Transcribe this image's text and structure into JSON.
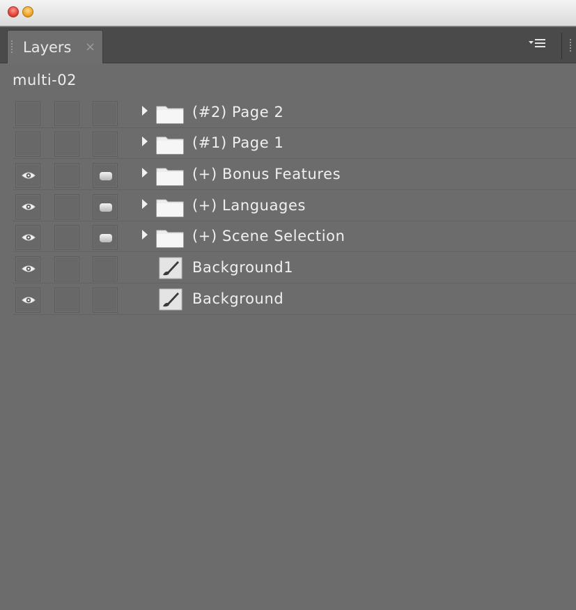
{
  "panel": {
    "tab_label": "Layers",
    "tab_close": "×",
    "menu_icon": "panel-menu-icon",
    "document_name": "multi-02"
  },
  "layers": [
    {
      "name": "(#2) Page 2",
      "type": "folder",
      "visible": false,
      "locked_marker": false
    },
    {
      "name": "(#1) Page 1",
      "type": "folder",
      "visible": false,
      "locked_marker": false
    },
    {
      "name": "(+) Bonus Features",
      "type": "folder",
      "visible": true,
      "locked_marker": true
    },
    {
      "name": "(+) Languages",
      "type": "folder",
      "visible": true,
      "locked_marker": true
    },
    {
      "name": "(+) Scene Selection",
      "type": "folder",
      "visible": true,
      "locked_marker": true
    },
    {
      "name": "Background1",
      "type": "layer",
      "visible": true,
      "locked_marker": false
    },
    {
      "name": "Background",
      "type": "layer",
      "visible": true,
      "locked_marker": false
    }
  ],
  "colors": {
    "panel_bg": "#6c6c6c",
    "tabbar_bg": "#4a4a4a",
    "text": "#f0f0f0"
  }
}
